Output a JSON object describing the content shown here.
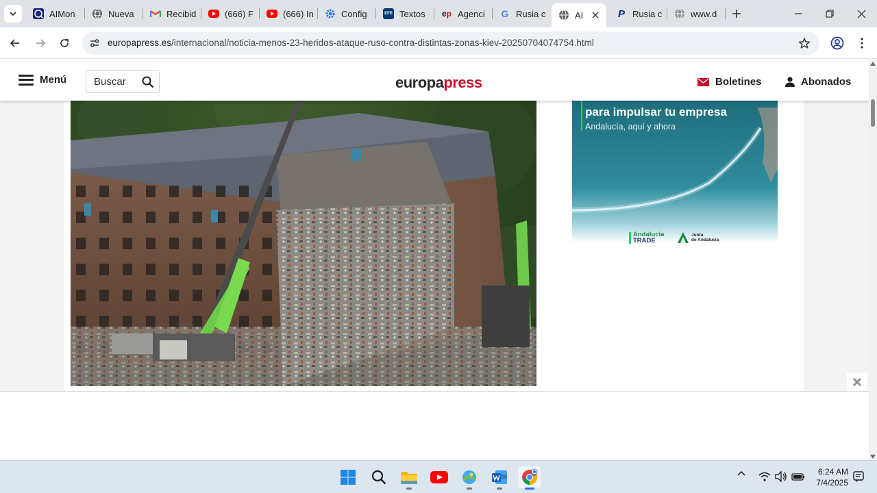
{
  "browser": {
    "tabs": [
      {
        "title": "AIMon",
        "icon": "aimon-icon"
      },
      {
        "title": "Nueva",
        "icon": "globe-icon"
      },
      {
        "title": "Recibid",
        "icon": "gmail-icon"
      },
      {
        "title": "(666) F",
        "icon": "youtube-icon"
      },
      {
        "title": "(666) In",
        "icon": "youtube-icon"
      },
      {
        "title": "Config",
        "icon": "gear-icon"
      },
      {
        "title": "Textos",
        "icon": "efe-icon"
      },
      {
        "title": "Agenci",
        "icon": "ep-icon"
      },
      {
        "title": "Rusia c",
        "icon": "google-icon"
      },
      {
        "title": "AI",
        "icon": "globe-icon",
        "active": true
      },
      {
        "title": "Rusia c",
        "icon": "paypal-icon"
      },
      {
        "title": "www.d",
        "icon": "globe-icon"
      }
    ],
    "url_domain": "europapress.es",
    "url_path": "/internacional/noticia-menos-23-heridos-ataque-ruso-contra-distintas-zonas-kiev-20250704074754.html"
  },
  "site": {
    "menu_label": "Menú",
    "search_placeholder": "Buscar",
    "logo_part1": "europa",
    "logo_part2": "press",
    "boletines_label": "Boletines",
    "abonados_label": "Abonados"
  },
  "ad": {
    "headline": "para impulsar tu empresa",
    "subline": "Andalucía, aquí y ahora",
    "brand1_line1": "Andalucía",
    "brand1_line2": "TRADE",
    "brand2_line1": "Junta",
    "brand2_line2": "de Andalucía"
  },
  "taskbar": {
    "time": "6:24 AM",
    "date": "7/4/2025",
    "apps": [
      "windows-start-icon",
      "search-icon",
      "file-explorer-icon",
      "youtube-icon",
      "photos-icon",
      "word-icon",
      "chrome-icon"
    ]
  },
  "colors": {
    "brand_red": "#c8102e",
    "tabstrip": "#dfe3e8",
    "ad_green": "#2ecc71"
  }
}
